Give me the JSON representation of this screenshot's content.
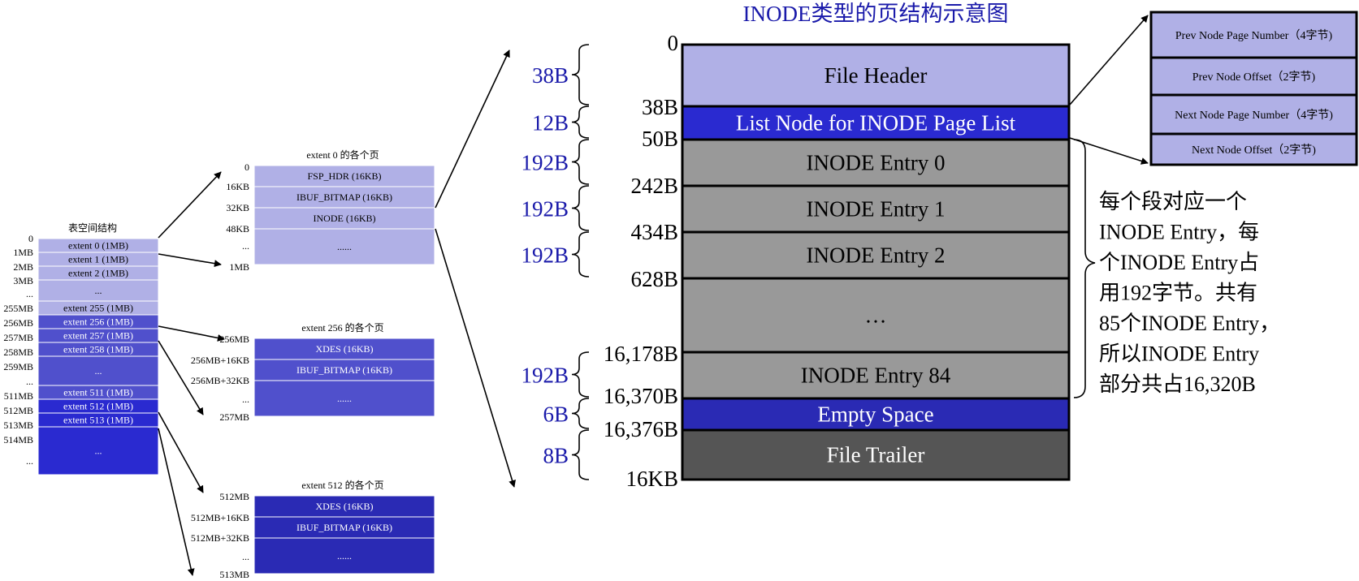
{
  "colors": {
    "light": "#b0b0e6",
    "mid": "#5050cc",
    "dark": "#2a2ad0",
    "deep": "#2a2ab4",
    "gray": "#999999",
    "darkgray": "#555555",
    "accent_text": "#1a1aaa"
  },
  "tablespace": {
    "title": "表空间结构",
    "rows": [
      {
        "label": "extent 0 (1MB)",
        "style": "light"
      },
      {
        "label": "extent 1 (1MB)",
        "style": "light"
      },
      {
        "label": "extent 2 (1MB)",
        "style": "light"
      },
      {
        "label": "...",
        "style": "light"
      },
      {
        "label": "extent 255 (1MB)",
        "style": "light"
      },
      {
        "label": "extent 256 (1MB)",
        "style": "mid"
      },
      {
        "label": "extent 257 (1MB)",
        "style": "mid"
      },
      {
        "label": "extent 258 (1MB)",
        "style": "mid"
      },
      {
        "label": "...",
        "style": "mid"
      },
      {
        "label": "extent 511 (1MB)",
        "style": "mid"
      },
      {
        "label": "extent 512 (1MB)",
        "style": "dark"
      },
      {
        "label": "extent 513 (1MB)",
        "style": "dark"
      },
      {
        "label": "...",
        "style": "dark"
      }
    ],
    "offsets": [
      "0",
      "1MB",
      "2MB",
      "3MB",
      "...",
      "255MB",
      "256MB",
      "257MB",
      "258MB",
      "259MB",
      "...",
      "511MB",
      "512MB",
      "513MB",
      "514MB",
      "..."
    ]
  },
  "extent_groups": [
    {
      "title": "extent 0 的各个页",
      "style": "light",
      "rows": [
        "FSP_HDR (16KB)",
        "IBUF_BITMAP (16KB)",
        "INODE (16KB)",
        "......"
      ],
      "offsets": [
        "0",
        "16KB",
        "32KB",
        "48KB",
        "...",
        "1MB"
      ]
    },
    {
      "title": "extent 256 的各个页",
      "style": "mid",
      "rows": [
        "XDES (16KB)",
        "IBUF_BITMAP (16KB)",
        "......"
      ],
      "offsets": [
        "256MB",
        "256MB+16KB",
        "256MB+32KB",
        "...",
        "257MB"
      ]
    },
    {
      "title": "extent 512 的各个页",
      "style": "deep",
      "rows": [
        "XDES (16KB)",
        "IBUF_BITMAP (16KB)",
        "......"
      ],
      "offsets": [
        "512MB",
        "512MB+16KB",
        "512MB+32KB",
        "...",
        "513MB"
      ]
    }
  ],
  "inode_page": {
    "title": "INODE类型的页结构示意图",
    "rows": [
      {
        "label": "File Header",
        "style": "light"
      },
      {
        "label": "List Node for INODE Page List",
        "style": "dark"
      },
      {
        "label": "INODE Entry 0",
        "style": "gray"
      },
      {
        "label": "INODE Entry 1",
        "style": "gray"
      },
      {
        "label": "INODE Entry 2",
        "style": "gray"
      },
      {
        "label": "…",
        "style": "gray"
      },
      {
        "label": "INODE Entry 84",
        "style": "gray"
      },
      {
        "label": "Empty Space",
        "style": "deep"
      },
      {
        "label": "File Trailer",
        "style": "darkgray"
      }
    ],
    "offsets": [
      "0",
      "38B",
      "50B",
      "242B",
      "434B",
      "628B",
      "16,178B",
      "16,370B",
      "16,376B",
      "16KB"
    ],
    "sizes": [
      "38B",
      "12B",
      "192B",
      "192B",
      "192B",
      "192B",
      "6B",
      "8B"
    ]
  },
  "list_node": {
    "rows": [
      "Prev Node Page Number（4字节)",
      "Prev Node Offset（2字节)",
      "Next Node Page Number（4字节)",
      "Next Node Offset（2字节)"
    ]
  },
  "note": {
    "lines": [
      "每个段对应一个",
      "INODE Entry，每",
      "个INODE Entry占",
      "用192字节。共有",
      "85个INODE Entry，",
      "所以INODE Entry",
      "部分共占16,320B"
    ]
  }
}
